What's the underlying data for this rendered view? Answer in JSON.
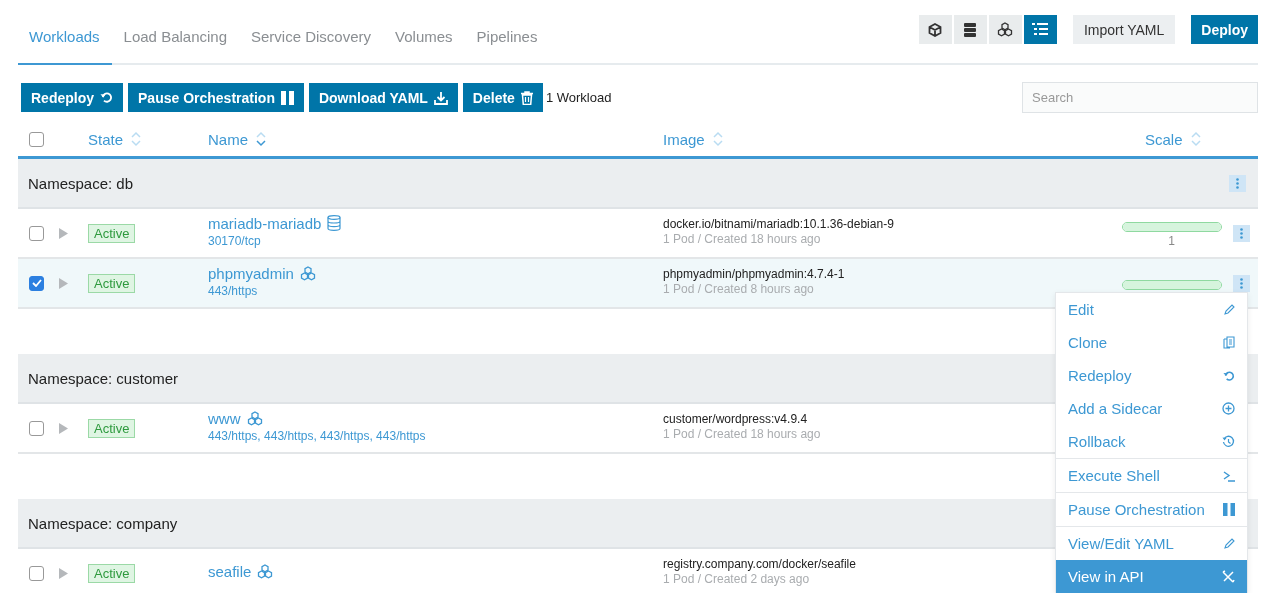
{
  "tabs": [
    {
      "label": "Workloads",
      "selected": true
    },
    {
      "label": "Load Balancing",
      "selected": false
    },
    {
      "label": "Service Discovery",
      "selected": false
    },
    {
      "label": "Volumes",
      "selected": false
    },
    {
      "label": "Pipelines",
      "selected": false
    }
  ],
  "view_toggles": [
    {
      "selected": false
    },
    {
      "selected": false
    },
    {
      "selected": false
    },
    {
      "selected": true
    }
  ],
  "header_buttons": [
    {
      "label": "Import YAML",
      "kind": "secondary"
    },
    {
      "label": "Deploy",
      "kind": "primary"
    }
  ],
  "bulk_actions": [
    {
      "label": "Redeploy"
    },
    {
      "label": "Pause Orchestration"
    },
    {
      "label": "Download YAML"
    },
    {
      "label": "Delete"
    }
  ],
  "selection_count": "1 Workload",
  "search": {
    "placeholder": "Search"
  },
  "table": {
    "select_all_checked": false,
    "columns": [
      {
        "label": "State",
        "sorted": false
      },
      {
        "label": "Name",
        "sorted": true
      },
      {
        "label": "Image",
        "sorted": false
      },
      {
        "label": "Scale",
        "sorted": false
      }
    ],
    "groups": [
      {
        "title": "Namespace: db",
        "actions": true,
        "rows": [
          {
            "checked": false,
            "state": "Active",
            "name": "mariadb-mariadb",
            "kind": "stateful",
            "ports": "30170/tcp",
            "image": "docker.io/bitnami/mariadb:10.1.36-debian-9",
            "detail": "1 Pod / Created 18 hours ago",
            "scale": {
              "level": 1,
              "reading": "1"
            },
            "actions": true
          },
          {
            "checked": true,
            "state": "Active",
            "name": "phpmyadmin",
            "kind": "deployment",
            "ports": "443/https",
            "image": "phpmyadmin/phpmyadmin:4.7.4-1",
            "detail": "1 Pod / Created 8 hours ago",
            "scale": {
              "level": 1
            },
            "actions": true
          }
        ]
      },
      {
        "title": "Namespace: customer",
        "rows": [
          {
            "checked": false,
            "state": "Active",
            "name": "www",
            "kind": "deployment",
            "ports": "443/https, 443/https, 443/https, 443/https",
            "image": "customer/wordpress:v4.9.4",
            "detail": "1 Pod / Created 18 hours ago",
            "actions": false
          }
        ]
      },
      {
        "title": "Namespace: company",
        "rows": [
          {
            "checked": false,
            "state": "Active",
            "name": "seafile",
            "kind": "deployment",
            "image": "registry.company.com/docker/seafile",
            "detail": "1 Pod / Created 2 days ago",
            "actions": false
          }
        ]
      }
    ]
  },
  "context_menu": [
    [
      {
        "label": "Edit",
        "selected": false
      },
      {
        "label": "Clone",
        "selected": false
      },
      {
        "label": "Redeploy",
        "selected": false
      },
      {
        "label": "Add a Sidecar",
        "selected": false
      },
      {
        "label": "Rollback",
        "selected": false
      }
    ],
    [
      {
        "label": "Execute Shell",
        "selected": false
      }
    ],
    [
      {
        "label": "Pause Orchestration",
        "selected": false
      }
    ],
    [
      {
        "label": "View/Edit YAML",
        "selected": false
      },
      {
        "label": "View in API",
        "selected": true
      }
    ]
  ]
}
